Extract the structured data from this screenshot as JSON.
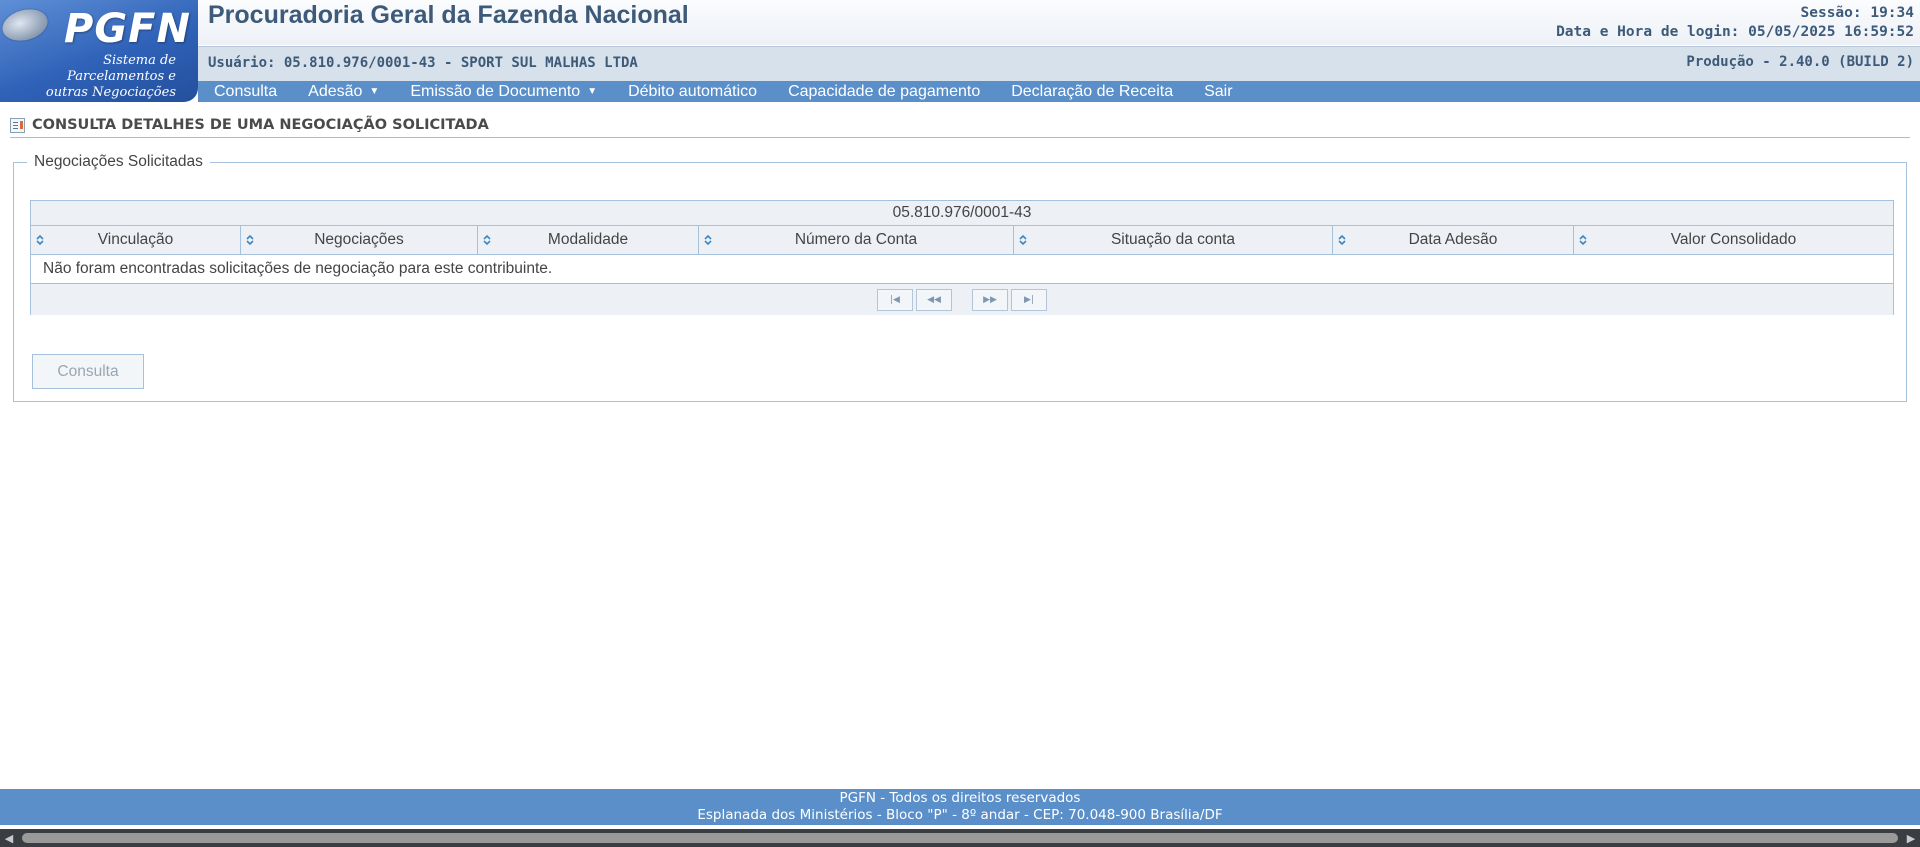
{
  "logo": {
    "brand": "PGFN",
    "tagline_line1": "Sistema de",
    "tagline_line2": "Parcelamentos e",
    "tagline_line3": "outras Negociações"
  },
  "header": {
    "title": "Procuradoria Geral da Fazenda Nacional",
    "session": "Sessão: 19:34",
    "login_datetime": "Data e Hora de login: 05/05/2025 16:59:52",
    "user": "Usuário: 05.810.976/0001-43 - SPORT SUL MALHAS LTDA",
    "version": "Produção - 2.40.0 (BUILD 2)"
  },
  "menu": {
    "items": [
      {
        "label": "Consulta",
        "dropdown": false
      },
      {
        "label": "Adesão",
        "dropdown": true
      },
      {
        "label": "Emissão de Documento",
        "dropdown": true
      },
      {
        "label": "Débito automático",
        "dropdown": false
      },
      {
        "label": "Capacidade de pagamento",
        "dropdown": false
      },
      {
        "label": "Declaração de Receita",
        "dropdown": false
      },
      {
        "label": "Sair",
        "dropdown": false
      }
    ]
  },
  "page": {
    "title": "CONSULTA DETALHES DE UMA NEGOCIAÇÃO SOLICITADA",
    "fieldset_legend": "Negociações Solicitadas"
  },
  "table": {
    "caption": "05.810.976/0001-43",
    "columns": [
      "Vinculação",
      "Negociações",
      "Modalidade",
      "Número da Conta",
      "Situação da conta",
      "Data Adesão",
      "Valor Consolidado"
    ],
    "empty_message": "Não foram encontradas solicitações de negociação para este contribuinte."
  },
  "paginator": {
    "first_icon": "first-page-icon",
    "prev_icon": "previous-page-icon",
    "next_icon": "next-page-icon",
    "last_icon": "last-page-icon"
  },
  "actions": {
    "consulta_button": "Consulta"
  },
  "footer": {
    "line1": "PGFN - Todos os direitos reservados",
    "line2": "Esplanada dos Ministérios - Bloco \"P\" - 8º andar - CEP: 70.048-900 Brasília/DF"
  },
  "colors": {
    "menu_bar": "#5a8fc9",
    "title_text": "#3d5a78",
    "border": "#a6c1dc",
    "footer": "#5a8fc9"
  }
}
